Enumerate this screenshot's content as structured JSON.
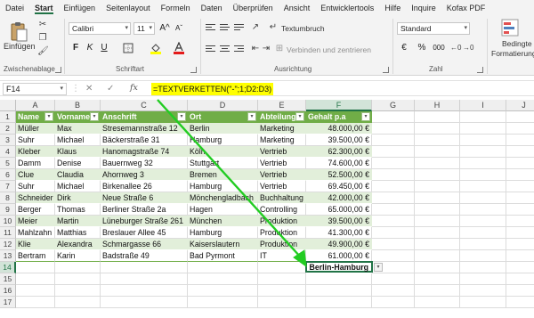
{
  "ribbon_tabs": [
    "Datei",
    "Start",
    "Einfügen",
    "Seitenlayout",
    "Formeln",
    "Daten",
    "Überprüfen",
    "Ansicht",
    "Entwicklertools",
    "Hilfe",
    "Inquire",
    "Kofax PDF"
  ],
  "active_tab": "Start",
  "clipboard": {
    "paste_label": "Einfügen",
    "group_label": "Zwischenablage"
  },
  "font": {
    "family": "Calibri",
    "size": "11",
    "grow": "A^",
    "shrink": "Aˇ",
    "bold": "F",
    "italic": "K",
    "underline": "U",
    "group_label": "Schriftart"
  },
  "alignment": {
    "wrap_text": "Textumbruch",
    "merge_center": "Verbinden und zentrieren",
    "group_label": "Ausrichtung"
  },
  "number": {
    "format": "Standard",
    "currency": "€",
    "percent": "%",
    "thousands": "000",
    "group_label": "Zahl"
  },
  "styles": {
    "conditional_line1": "Bedingte",
    "conditional_line2": "Formatierung"
  },
  "formula_bar": {
    "name_box": "F14",
    "cancel": "✕",
    "confirm": "✓",
    "fx": "fx",
    "formula": "=TEXTVERKETTEN(\"-\";1;D2:D3)"
  },
  "columns": [
    "A",
    "B",
    "C",
    "D",
    "E",
    "F",
    "G",
    "H",
    "I",
    "J"
  ],
  "rows": [
    "1",
    "2",
    "3",
    "4",
    "5",
    "6",
    "7",
    "8",
    "9",
    "10",
    "11",
    "12",
    "13",
    "14",
    "15",
    "16",
    "17"
  ],
  "table": {
    "headers": [
      "Name",
      "Vorname",
      "Anschrift",
      "Ort",
      "Abteilung",
      "Gehalt p.a"
    ],
    "rows": [
      [
        "Müller",
        "Max",
        "Stresemannstraße 12",
        "Berlin",
        "Marketing",
        "48.000,00 €"
      ],
      [
        "Suhr",
        "Michael",
        "Bäckerstraße 31",
        "Hamburg",
        "Marketing",
        "39.500,00 €"
      ],
      [
        "Kleber",
        "Klaus",
        "Hanomagstraße 74",
        "Köln",
        "Vertrieb",
        "62.300,00 €"
      ],
      [
        "Damm",
        "Denise",
        "Bauernweg 32",
        "Stuttgart",
        "Vertrieb",
        "74.600,00 €"
      ],
      [
        "Clue",
        "Claudia",
        "Ahornweg 3",
        "Bremen",
        "Vertrieb",
        "52.500,00 €"
      ],
      [
        "Suhr",
        "Michael",
        "Birkenallee 26",
        "Hamburg",
        "Vertrieb",
        "69.450,00 €"
      ],
      [
        "Schneider",
        "Dirk",
        "Neue Straße 6",
        "Mönchengladbach",
        "Buchhaltung",
        "42.000,00 €"
      ],
      [
        "Berger",
        "Thomas",
        "Berliner Straße 2a",
        "Hagen",
        "Controlling",
        "65.000,00 €"
      ],
      [
        "Meier",
        "Martin",
        "Lüneburger Straße 261",
        "München",
        "Produktion",
        "39.500,00 €"
      ],
      [
        "Mahlzahn",
        "Matthias",
        "Breslauer Allee 45",
        "Hamburg",
        "Produktion",
        "41.300,00 €"
      ],
      [
        "Klie",
        "Alexandra",
        "Schmargasse 66",
        "Kaiserslautern",
        "Produktion",
        "49.900,00 €"
      ],
      [
        "Bertram",
        "Karin",
        "Badstraße 49",
        "Bad Pyrmont",
        "IT",
        "61.000,00 €"
      ]
    ]
  },
  "result_cell": "Berlin-Hamburg",
  "colors": {
    "header_green": "#70AD47",
    "band_green": "#E2EFDA",
    "formula_highlight": "#FFFF00",
    "arrow": "#22CC22",
    "excel_green": "#217346"
  }
}
